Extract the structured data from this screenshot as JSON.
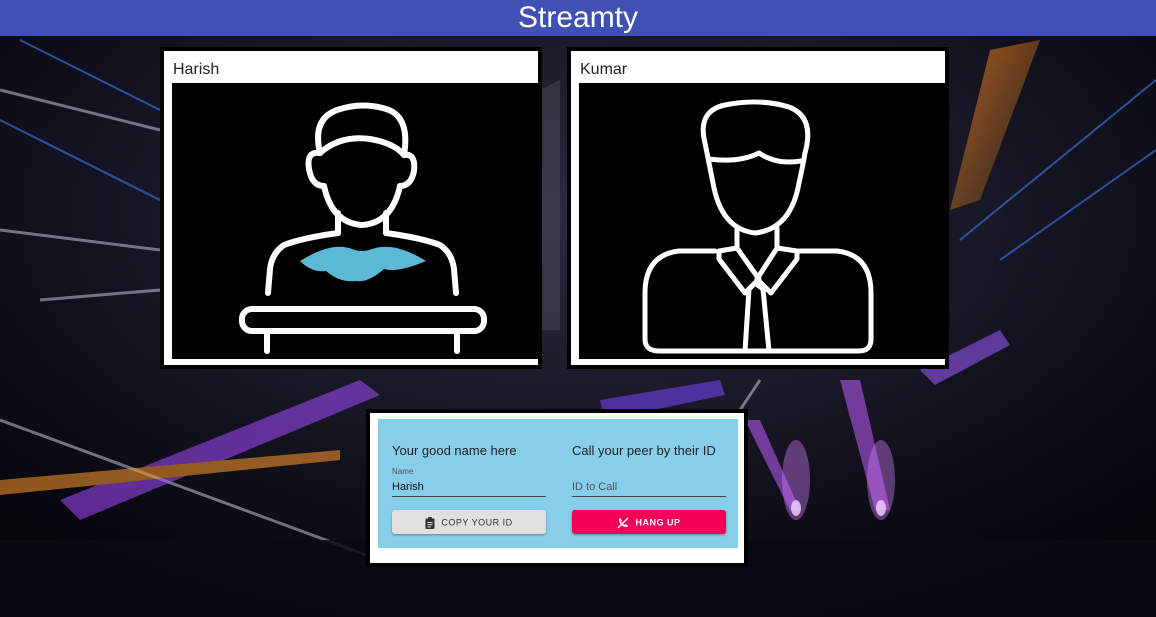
{
  "app": {
    "title": "Streamty"
  },
  "videos": [
    {
      "name": "Harish",
      "avatar": "person-icon"
    },
    {
      "name": "Kumar",
      "avatar": "businessman-icon"
    }
  ],
  "controls": {
    "name_section": {
      "title": "Your good name here",
      "name_label": "Name",
      "name_value": "Harish",
      "copy_button": "COPY YOUR ID",
      "copy_icon": "clipboard-icon"
    },
    "call_section": {
      "title": "Call your peer by their ID",
      "id_placeholder": "ID to Call",
      "hangup_button": "HANG UP",
      "hangup_icon": "call-end-icon"
    }
  },
  "colors": {
    "appbar": "#3f51b5",
    "panel": "#87ceeb",
    "hangup": "#f50057",
    "copy": "#e0e0e0",
    "avatar_accent": "#5bb9d6"
  }
}
